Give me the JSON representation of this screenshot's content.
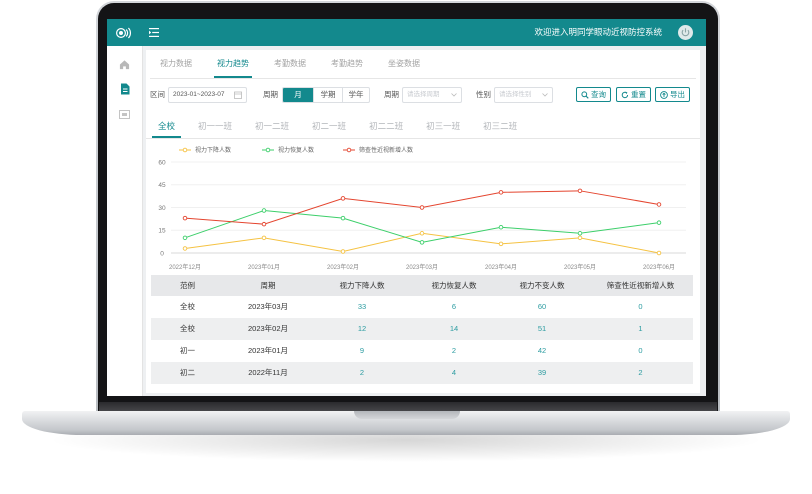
{
  "app": {
    "title": "欢迎进入明同学眼动近视防控系统",
    "logo_icon": "eye-logo-icon",
    "menu_icon": "menu-fold-icon",
    "power_icon": "power-icon",
    "accent_color": "#13898d"
  },
  "sidebar": {
    "items": [
      {
        "icon": "home-icon",
        "active": false
      },
      {
        "icon": "document-icon",
        "active": true
      },
      {
        "icon": "monitor-icon",
        "active": false
      }
    ]
  },
  "tabs": {
    "items": [
      "视力数据",
      "视力趋势",
      "考勤数据",
      "考勤趋势",
      "坐姿数据"
    ],
    "active": "视力趋势"
  },
  "filters": {
    "range": {
      "label": "区间",
      "value": "2023-01~2023-07",
      "icon": "calendar-icon"
    },
    "period": {
      "label": "周期",
      "options": [
        "月",
        "学期",
        "学年"
      ],
      "selected": "月"
    },
    "cycle": {
      "label": "周期",
      "placeholder": "请选择周期",
      "icon": "chevron-down-icon"
    },
    "gender": {
      "label": "性别",
      "placeholder": "请选择性别",
      "icon": "chevron-down-icon"
    },
    "buttons": {
      "query": "查询",
      "reset": "重置",
      "export": "导出"
    }
  },
  "class_tabs": {
    "items": [
      "全校",
      "初一一班",
      "初一二班",
      "初二一班",
      "初二二班",
      "初三一班",
      "初三二班"
    ],
    "active": "全校"
  },
  "chart_data": {
    "type": "line",
    "x": [
      "2022年12月",
      "2023年01月",
      "2023年02月",
      "2023年03月",
      "2023年04月",
      "2023年05月",
      "2023年06月"
    ],
    "series": [
      {
        "name": "视力下降人数",
        "color": "#f5c242",
        "values": [
          3,
          10,
          1,
          13,
          6,
          10,
          0
        ]
      },
      {
        "name": "视力恢复人数",
        "color": "#3ccf6a",
        "values": [
          10,
          28,
          23,
          7,
          17,
          13,
          20
        ]
      },
      {
        "name": "筛查性近视新增人数",
        "color": "#e4452f",
        "values": [
          23,
          19,
          36,
          30,
          40,
          41,
          32
        ]
      }
    ],
    "yticks": [
      0,
      15,
      30,
      45,
      60
    ],
    "ylim": [
      0,
      60
    ],
    "legend": "top-center",
    "grid": true
  },
  "table": {
    "headers": [
      "范例",
      "周期",
      "视力下降人数",
      "视力恢复人数",
      "视力不变人数",
      "筛查性近视新增人数"
    ],
    "rows": [
      [
        "全校",
        "2023年03月",
        33,
        6,
        60,
        0
      ],
      [
        "全校",
        "2023年02月",
        12,
        14,
        51,
        1
      ],
      [
        "初一",
        "2023年01月",
        9,
        2,
        42,
        0
      ],
      [
        "初二",
        "2022年11月",
        2,
        4,
        39,
        2
      ]
    ]
  }
}
